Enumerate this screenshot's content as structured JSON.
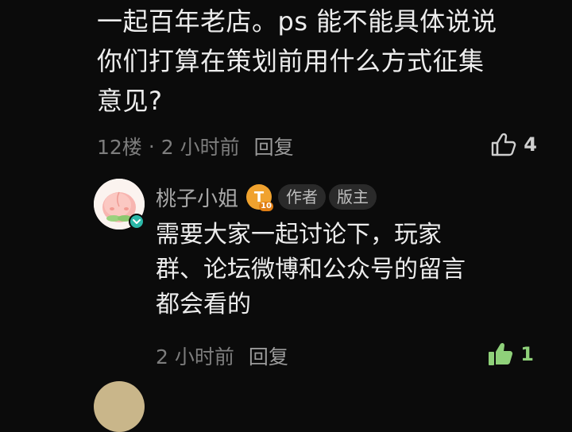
{
  "comment": {
    "lines": [
      "一起百年老店。ps 能不能具体说说",
      "你们打算在策划前用什么方式征集",
      "意见?"
    ],
    "floor": "12楼",
    "separator": "·",
    "time": "2 小时前",
    "reply_label": "回复",
    "like_count": "4"
  },
  "reply": {
    "username": "桃子小姐",
    "level_badge_letter": "T",
    "level_badge_number": "10",
    "tags": [
      "作者",
      "版主"
    ],
    "lines": [
      "需要大家一起讨论下，玩家",
      "群、论坛微博和公众号的留言",
      "都会看的"
    ],
    "time": "2 小时前",
    "reply_label": "回复",
    "like_count": "1"
  },
  "colors": {
    "background": "#0b0b0b",
    "liked_accent": "#8fd17a",
    "level_badge": "#f0a22e",
    "verify_badge": "#2bb8a8"
  }
}
